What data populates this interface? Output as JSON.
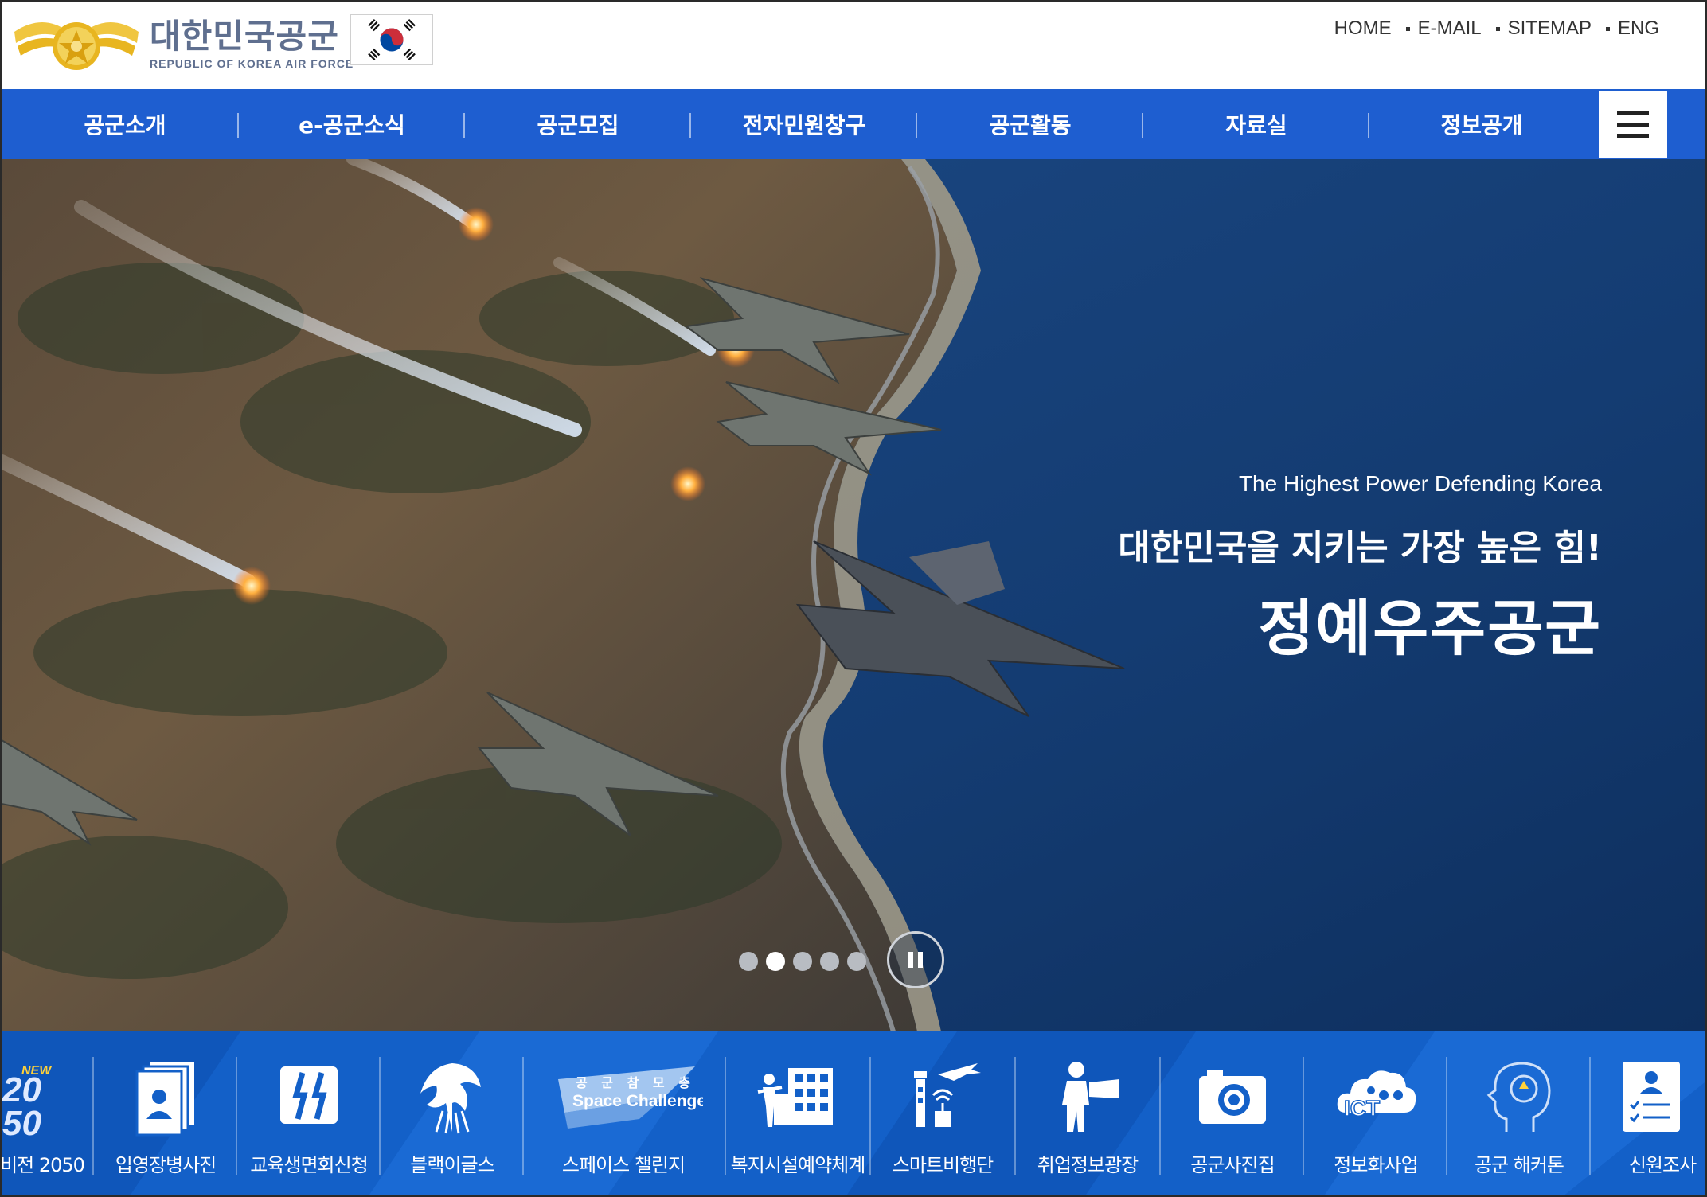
{
  "header": {
    "brand_ko": "대한민국공군",
    "brand_en": "REPUBLIC OF KOREA AIR FORCE",
    "util_links": [
      "HOME",
      "E-MAIL",
      "SITEMAP",
      "ENG"
    ]
  },
  "nav": {
    "items": [
      "공군소개",
      "e-공군소식",
      "공군모집",
      "전자민원창구",
      "공군활동",
      "자료실",
      "정보공개"
    ]
  },
  "hero": {
    "subtitle": "The Highest Power Defending Korea",
    "title_line1": "대한민국을 지키는 가장 높은 힘!",
    "title_line2": "정예우주공군",
    "slides_total": 5,
    "active_slide": 2
  },
  "quick_menu": {
    "new_badge": "NEW",
    "vision_number_top": "20",
    "vision_number_bottom": "50",
    "space_banner_top": "공 군 참 모 총 장 배",
    "space_banner_bottom": "Space Challenge",
    "ict_text": "ICT",
    "items": [
      {
        "label": "비전 2050",
        "icon": "vision-2050-icon"
      },
      {
        "label": "입영장병사진",
        "icon": "soldier-photo-icon"
      },
      {
        "label": "교육생면회신청",
        "icon": "visit-request-icon"
      },
      {
        "label": "블랙이글스",
        "icon": "black-eagles-icon"
      },
      {
        "label": "스페이스 챌린지",
        "icon": "space-challenge-icon"
      },
      {
        "label": "복지시설예약체계",
        "icon": "welfare-facility-icon"
      },
      {
        "label": "스마트비행단",
        "icon": "smart-wing-icon"
      },
      {
        "label": "취업정보광장",
        "icon": "job-info-icon"
      },
      {
        "label": "공군사진집",
        "icon": "camera-icon"
      },
      {
        "label": "정보화사업",
        "icon": "ict-cloud-icon"
      },
      {
        "label": "공군 해커톤",
        "icon": "hackathon-head-icon"
      },
      {
        "label": "신원조사",
        "icon": "identity-check-icon"
      }
    ]
  },
  "colors": {
    "nav_blue": "#1e5ed0",
    "quick_blue": "#1360c8",
    "brand_gray": "#5f6f8f",
    "logo_gold": "#e8b520",
    "flag_red": "#cd2e3a",
    "flag_blue": "#0047a0"
  }
}
